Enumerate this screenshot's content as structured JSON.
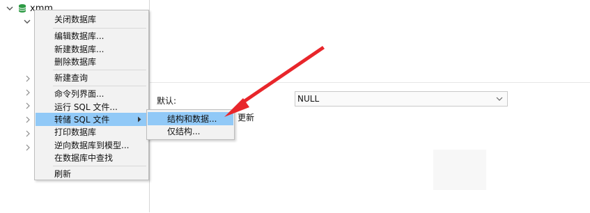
{
  "tree": {
    "db_name": "xmm",
    "db_icon_color": "#2e9b45"
  },
  "context_menu": {
    "items": [
      {
        "label": "关闭数据库"
      },
      {
        "label": "编辑数据库..."
      },
      {
        "label": "新建数据库..."
      },
      {
        "label": "删除数据库"
      },
      {
        "label": "新建查询"
      },
      {
        "label": "命令列界面..."
      },
      {
        "label": "运行 SQL 文件..."
      },
      {
        "label": "转储 SQL 文件",
        "highlighted": true,
        "has_submenu": true
      },
      {
        "label": "打印数据库"
      },
      {
        "label": "逆向数据库到模型..."
      },
      {
        "label": "在数据库中查找"
      },
      {
        "label": "刷新"
      }
    ],
    "highlight_color": "#91c9f7"
  },
  "submenu": {
    "items": [
      {
        "label": "结构和数据...",
        "highlighted": true
      },
      {
        "label": "仅结构..."
      }
    ]
  },
  "properties": {
    "default_label": "默认:",
    "default_value": "NULL",
    "partial_text": "更新"
  },
  "annotation": {
    "type": "arrow",
    "color": "#e8262b",
    "target": "结构和数据..."
  }
}
